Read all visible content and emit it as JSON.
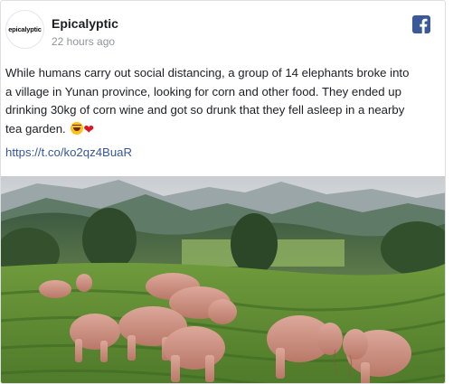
{
  "post": {
    "avatar_text": "epicalyptic",
    "page_name": "Epicalyptic",
    "timestamp": "22 hours ago",
    "text_line1": "While humans carry out social distancing, a group of 14 elephants broke into",
    "text_line2": "a village in Yunan province, looking for corn and other food. They ended up",
    "text_line3": "drinking 30kg of corn wine and got so drunk that they fell asleep in a nearby",
    "text_line4": "tea garden.",
    "emojis": [
      "laughing-with-tears-emoji",
      "red-heart-emoji"
    ],
    "link": "https://t.co/ko2qz4BuaR",
    "photo_subject": "elephants-sleeping-in-tea-garden",
    "share_icon": "facebook-icon"
  },
  "colors": {
    "link": "#365899",
    "facebook_blue": "#3b5998",
    "text": "#1c1e21",
    "meta": "#90949c"
  }
}
